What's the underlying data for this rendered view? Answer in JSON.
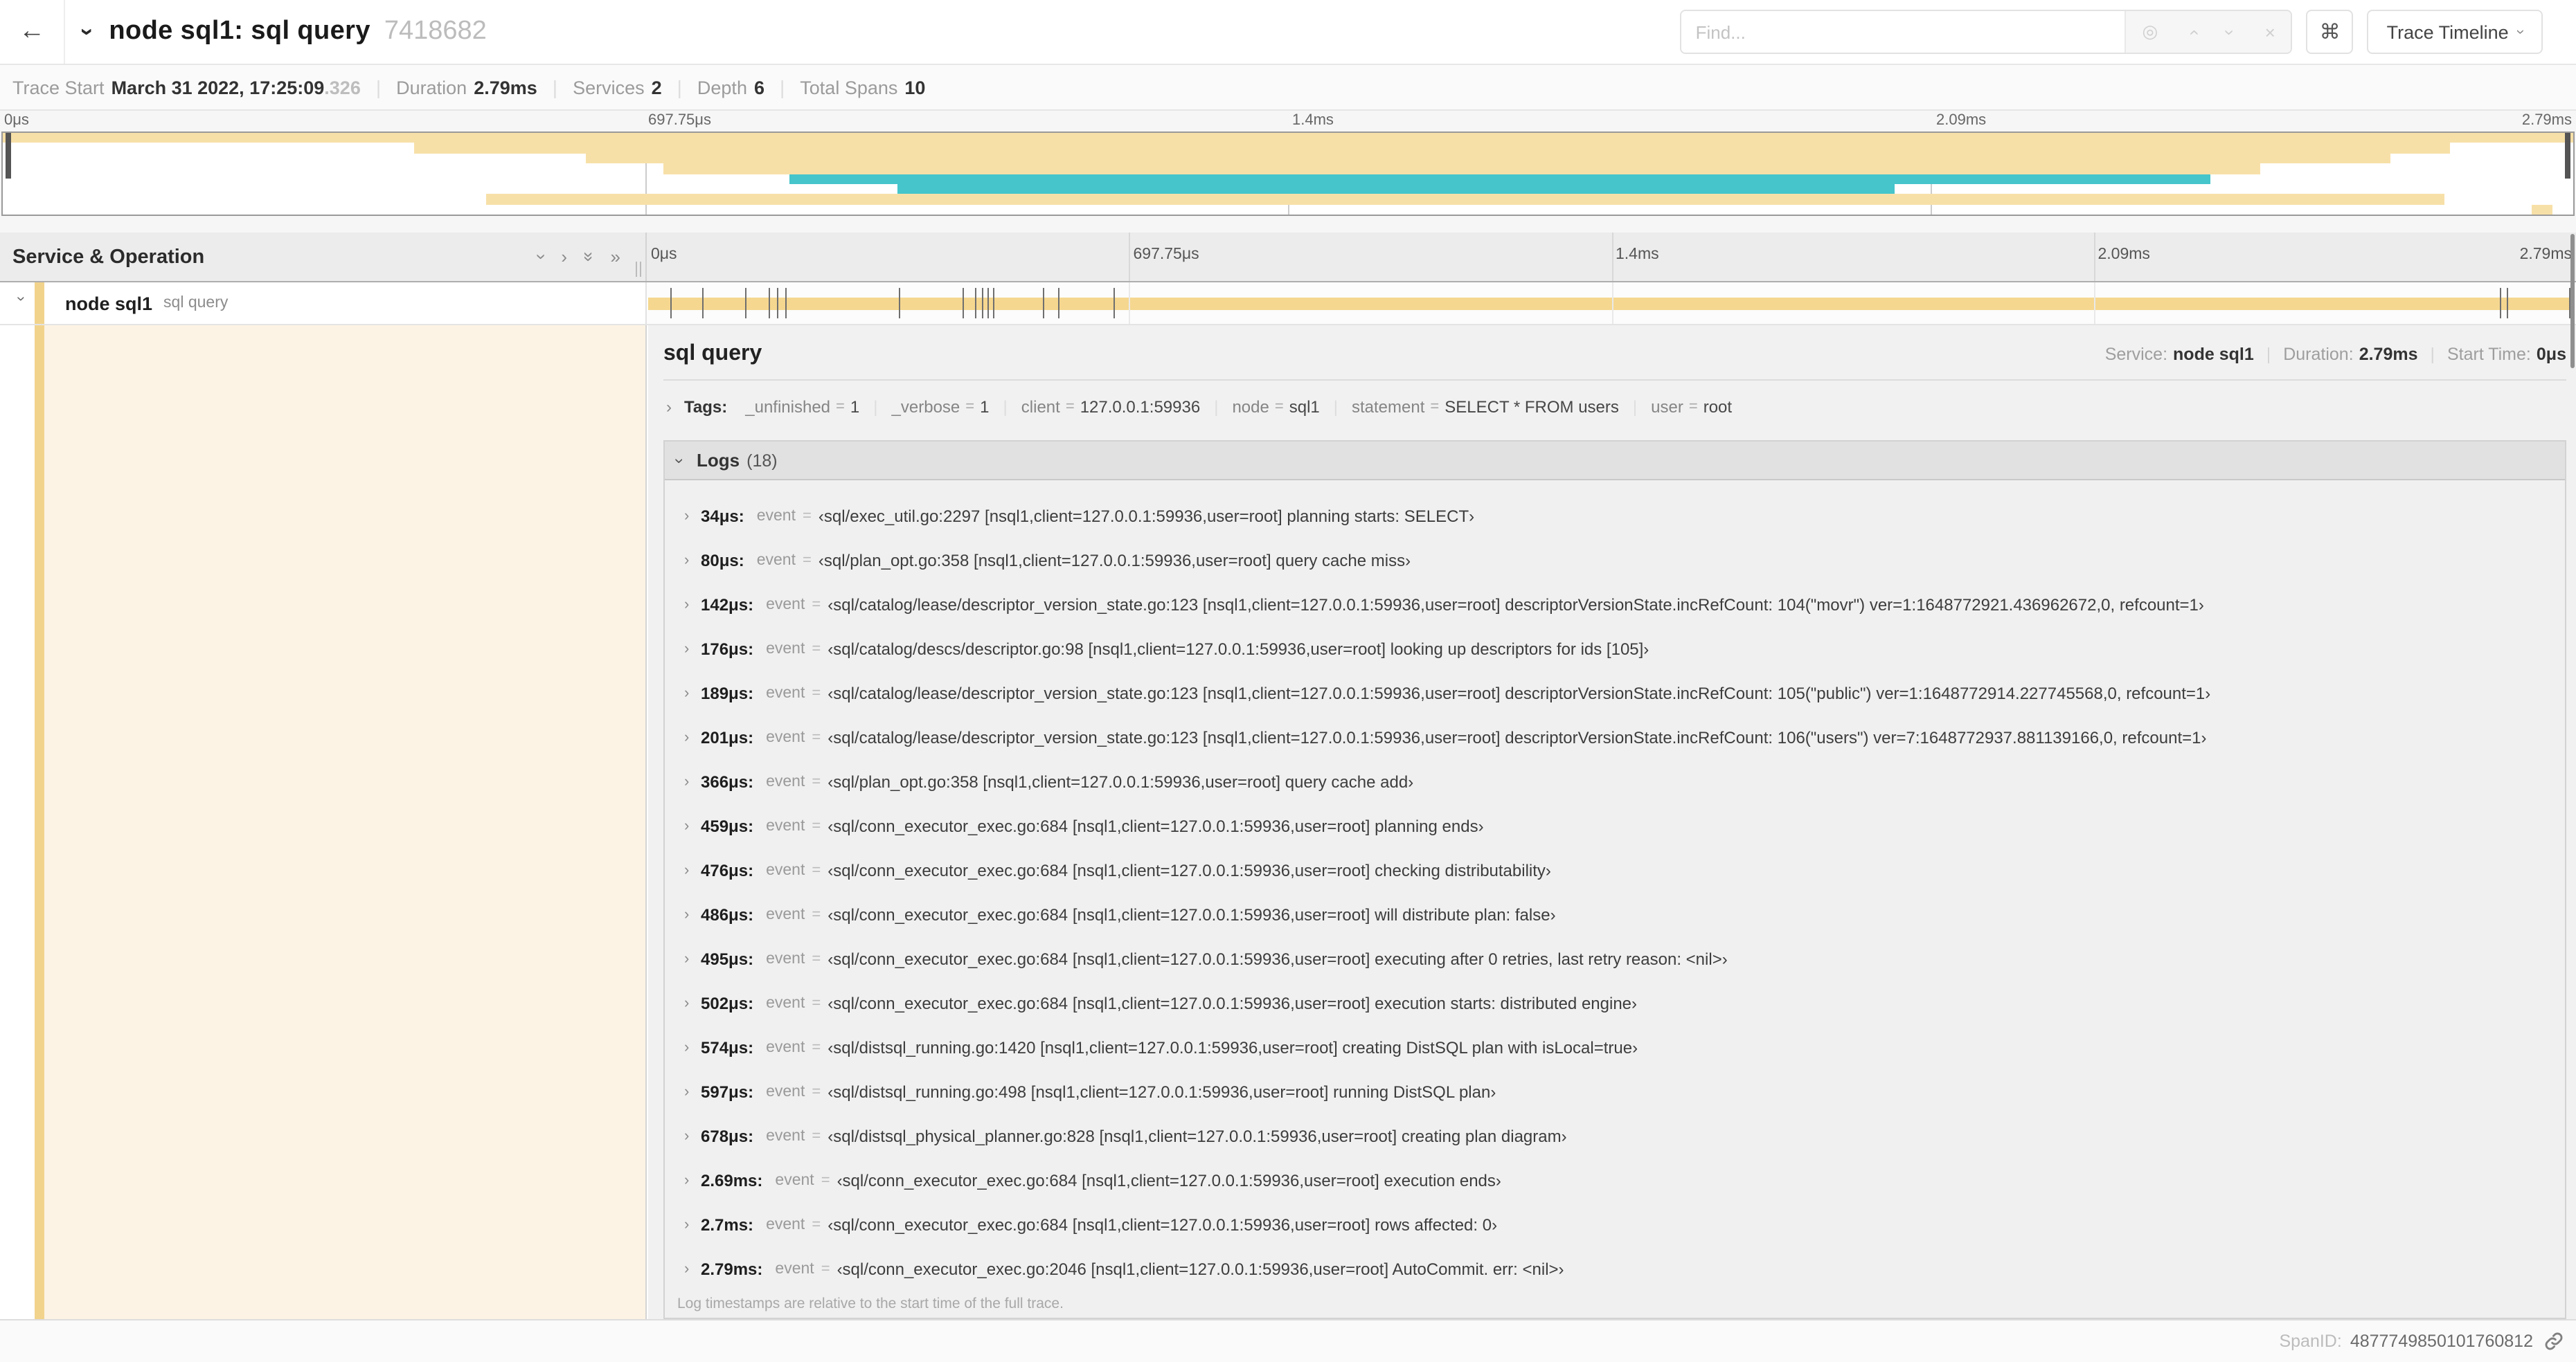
{
  "icons": {
    "back": "←",
    "chevron": "›",
    "double_chevron": "»",
    "target": "◎",
    "close": "×",
    "command": "⌘"
  },
  "header": {
    "title": "node sql1: sql query",
    "trace_id": "7418682",
    "find_placeholder": "Find...",
    "view_selector": "Trace Timeline"
  },
  "trace_info": {
    "trace_start_label": "Trace Start",
    "trace_start_value": "March 31 2022, 17:25:09",
    "trace_start_fraction": ".326",
    "duration_label": "Duration",
    "duration_value": "2.79ms",
    "services_label": "Services",
    "services_value": "2",
    "depth_label": "Depth",
    "depth_value": "6",
    "total_spans_label": "Total Spans",
    "total_spans_value": "10"
  },
  "timeline": {
    "ticks": [
      "0μs",
      "697.75μs",
      "1.4ms",
      "2.09ms",
      "2.79ms"
    ],
    "columns_header": "Service & Operation",
    "duration_us": 2790
  },
  "minimap": {
    "spans": [
      {
        "start": 0,
        "end": 100,
        "color": "tan"
      },
      {
        "start": 16,
        "end": 95.2,
        "color": "tan"
      },
      {
        "start": 22.7,
        "end": 92.9,
        "color": "tan"
      },
      {
        "start": 25.7,
        "end": 87.8,
        "color": "tan"
      },
      {
        "start": 30.6,
        "end": 85.9,
        "color": "teal"
      },
      {
        "start": 34.8,
        "end": 73.6,
        "color": "teal"
      },
      {
        "start": 18.8,
        "end": 95,
        "color": "tan"
      },
      {
        "start": 98.4,
        "end": 99.2,
        "color": "tan"
      }
    ]
  },
  "span_row": {
    "service": "node sql1",
    "operation": "sql query"
  },
  "detail": {
    "title": "sql query",
    "service_label": "Service:",
    "service_value": "node sql1",
    "duration_label": "Duration:",
    "duration_value": "2.79ms",
    "start_time_label": "Start Time:",
    "start_time_value": "0μs",
    "tags_label": "Tags:",
    "tags": [
      {
        "key": "_unfinished",
        "value": "1"
      },
      {
        "key": "_verbose",
        "value": "1"
      },
      {
        "key": "client",
        "value": "127.0.0.1:59936"
      },
      {
        "key": "node",
        "value": "sql1"
      },
      {
        "key": "statement",
        "value": "SELECT * FROM users"
      },
      {
        "key": "user",
        "value": "root"
      }
    ],
    "logs_label": "Logs",
    "logs_count": "(18)",
    "event_label": "event",
    "logs": [
      {
        "time": "34μs:",
        "time_us": 34,
        "value": "‹sql/exec_util.go:2297 [nsql1,client=127.0.0.1:59936,user=root] planning starts: SELECT›"
      },
      {
        "time": "80μs:",
        "time_us": 80,
        "value": "‹sql/plan_opt.go:358 [nsql1,client=127.0.0.1:59936,user=root] query cache miss›"
      },
      {
        "time": "142μs:",
        "time_us": 142,
        "value": "‹sql/catalog/lease/descriptor_version_state.go:123 [nsql1,client=127.0.0.1:59936,user=root] descriptorVersionState.incRefCount: 104(\"movr\") ver=1:1648772921.436962672,0, refcount=1›"
      },
      {
        "time": "176μs:",
        "time_us": 176,
        "value": "‹sql/catalog/descs/descriptor.go:98 [nsql1,client=127.0.0.1:59936,user=root] looking up descriptors for ids [105]›"
      },
      {
        "time": "189μs:",
        "time_us": 189,
        "value": "‹sql/catalog/lease/descriptor_version_state.go:123 [nsql1,client=127.0.0.1:59936,user=root] descriptorVersionState.incRefCount: 105(\"public\") ver=1:1648772914.227745568,0, refcount=1›"
      },
      {
        "time": "201μs:",
        "time_us": 201,
        "value": "‹sql/catalog/lease/descriptor_version_state.go:123 [nsql1,client=127.0.0.1:59936,user=root] descriptorVersionState.incRefCount: 106(\"users\") ver=7:1648772937.881139166,0, refcount=1›"
      },
      {
        "time": "366μs:",
        "time_us": 366,
        "value": "‹sql/plan_opt.go:358 [nsql1,client=127.0.0.1:59936,user=root] query cache add›"
      },
      {
        "time": "459μs:",
        "time_us": 459,
        "value": "‹sql/conn_executor_exec.go:684 [nsql1,client=127.0.0.1:59936,user=root] planning ends›"
      },
      {
        "time": "476μs:",
        "time_us": 476,
        "value": "‹sql/conn_executor_exec.go:684 [nsql1,client=127.0.0.1:59936,user=root] checking distributability›"
      },
      {
        "time": "486μs:",
        "time_us": 486,
        "value": "‹sql/conn_executor_exec.go:684 [nsql1,client=127.0.0.1:59936,user=root] will distribute plan: false›"
      },
      {
        "time": "495μs:",
        "time_us": 495,
        "value": "‹sql/conn_executor_exec.go:684 [nsql1,client=127.0.0.1:59936,user=root] executing after 0 retries, last retry reason: <nil>›"
      },
      {
        "time": "502μs:",
        "time_us": 502,
        "value": "‹sql/conn_executor_exec.go:684 [nsql1,client=127.0.0.1:59936,user=root] execution starts: distributed engine›"
      },
      {
        "time": "574μs:",
        "time_us": 574,
        "value": "‹sql/distsql_running.go:1420 [nsql1,client=127.0.0.1:59936,user=root] creating DistSQL plan with isLocal=true›"
      },
      {
        "time": "597μs:",
        "time_us": 597,
        "value": "‹sql/distsql_running.go:498 [nsql1,client=127.0.0.1:59936,user=root] running DistSQL plan›"
      },
      {
        "time": "678μs:",
        "time_us": 678,
        "value": "‹sql/distsql_physical_planner.go:828 [nsql1,client=127.0.0.1:59936,user=root] creating plan diagram›"
      },
      {
        "time": "2.69ms:",
        "time_us": 2690,
        "value": "‹sql/conn_executor_exec.go:684 [nsql1,client=127.0.0.1:59936,user=root] execution ends›"
      },
      {
        "time": "2.7ms:",
        "time_us": 2700,
        "value": "‹sql/conn_executor_exec.go:684 [nsql1,client=127.0.0.1:59936,user=root] rows affected: 0›"
      },
      {
        "time": "2.79ms:",
        "time_us": 2790,
        "value": "‹sql/conn_executor_exec.go:2046 [nsql1,client=127.0.0.1:59936,user=root] AutoCommit. err: <nil>›"
      }
    ],
    "logs_footnote": "Log timestamps are relative to the start time of the full trace.",
    "span_id_label": "SpanID:",
    "span_id": "4877749850101760812"
  },
  "colors": {
    "span_bar": "#F5D78F",
    "minimap_tan": "#F7E0A8",
    "minimap_teal": "#46C5CB",
    "detail_left_bg": "#FCF3E4",
    "accent_strip": "#F2D38C"
  }
}
